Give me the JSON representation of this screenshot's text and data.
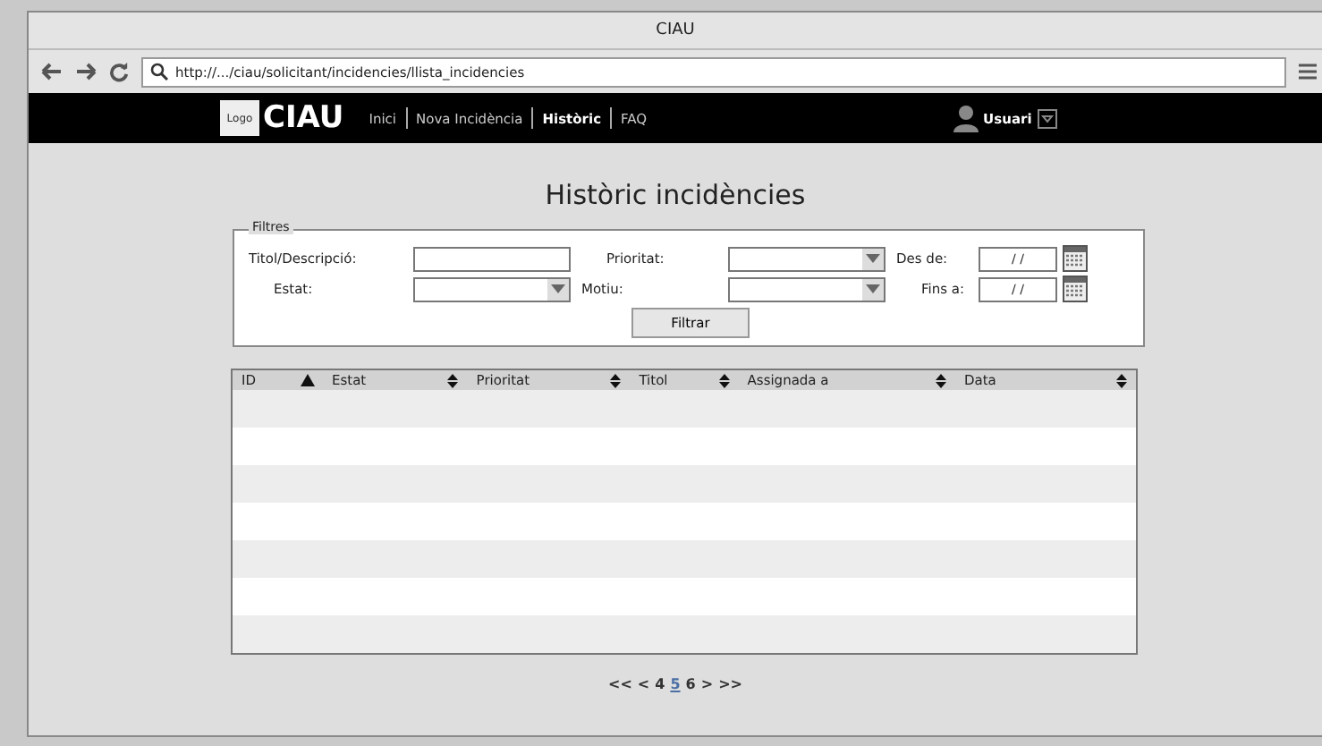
{
  "window": {
    "title": "CIAU"
  },
  "address_bar": {
    "url": "http://.../ciau/solicitant/incidencies/llista_incidencies"
  },
  "nav": {
    "logo": "Logo",
    "brand": "CIAU",
    "links": [
      {
        "label": "Inici",
        "selected": false
      },
      {
        "label": "Nova Incidència",
        "selected": false
      },
      {
        "label": "Històric",
        "selected": true
      },
      {
        "label": "FAQ",
        "selected": false
      }
    ],
    "user": "Usuari"
  },
  "heading": "Històric incidències",
  "filters": {
    "legend": "Filtres",
    "fields": [
      {
        "label": "Titol/Descripció:",
        "kind": "text"
      },
      {
        "label": "Prioritat:",
        "kind": "select"
      },
      {
        "label": "Des de:",
        "kind": "date",
        "value": "/ /"
      },
      {
        "label": "Estat:",
        "kind": "select"
      },
      {
        "label": "Motiu:",
        "kind": "select"
      },
      {
        "label": "Fins a:",
        "kind": "date",
        "value": "/ /"
      }
    ],
    "button": "Filtrar"
  },
  "table": {
    "columns": [
      {
        "label": "ID",
        "sorted": true
      },
      {
        "label": "Estat",
        "sorted": false
      },
      {
        "label": "Prioritat",
        "sorted": false
      },
      {
        "label": "Titol",
        "sorted": false
      },
      {
        "label": "Assignada a",
        "sorted": false
      },
      {
        "label": "Data",
        "sorted": false
      }
    ]
  },
  "pagination": [
    {
      "label": "<<",
      "selected": false
    },
    {
      "label": "<",
      "selected": false
    },
    {
      "label": "4",
      "selected": false
    },
    {
      "label": "5",
      "selected": true
    },
    {
      "label": "6",
      "selected": false
    },
    {
      "label": ">",
      "selected": false
    },
    {
      "label": ">>",
      "selected": false
    }
  ]
}
